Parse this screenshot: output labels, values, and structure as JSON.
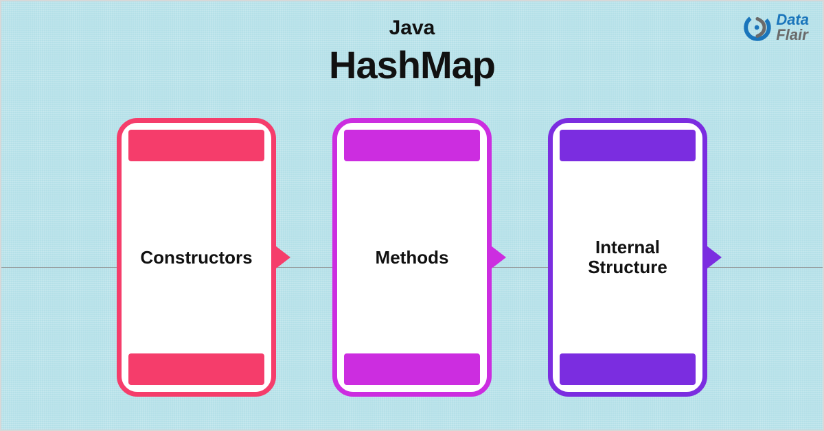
{
  "header": {
    "subtitle": "Java",
    "title": "HashMap"
  },
  "logo": {
    "text1": "Data",
    "text2": "Flair"
  },
  "cards": [
    {
      "label": "Constructors",
      "color": "#f53d6b"
    },
    {
      "label": "Methods",
      "color": "#cc2de0"
    },
    {
      "label": "Internal Structure",
      "color": "#7b2de0"
    }
  ]
}
